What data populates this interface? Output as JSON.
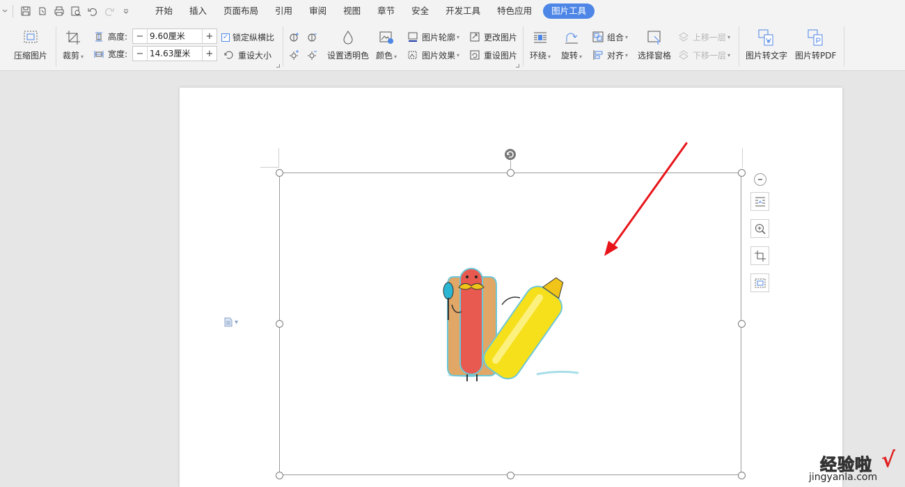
{
  "menu": {
    "tabs": [
      "开始",
      "插入",
      "页面布局",
      "引用",
      "审阅",
      "视图",
      "章节",
      "安全",
      "开发工具",
      "特色应用"
    ],
    "active_tab": "图片工具"
  },
  "ribbon": {
    "compress": "压缩图片",
    "crop": "裁剪",
    "height_label": "高度:",
    "height_value": "9.60厘米",
    "width_label": "宽度:",
    "width_value": "14.63厘米",
    "lock_ratio": "锁定纵横比",
    "reset_size": "重设大小",
    "transparent": "设置透明色",
    "color": "颜色",
    "outline": "图片轮廓",
    "effects": "图片效果",
    "change_pic": "更改图片",
    "reset_pic": "重设图片",
    "wrap": "环绕",
    "rotate": "旋转",
    "group": "组合",
    "align": "对齐",
    "selection_pane": "选择窗格",
    "bring_forward": "上移一层",
    "send_backward": "下移一层",
    "to_text": "图片转文字",
    "to_pdf": "图片转PDF",
    "minus": "−",
    "plus": "+"
  },
  "watermark": {
    "brand": "经验啦",
    "check": "√",
    "domain": "jingyanla.com"
  },
  "colors": {
    "accent": "#4d86e6",
    "arrow": "#e8141a"
  }
}
